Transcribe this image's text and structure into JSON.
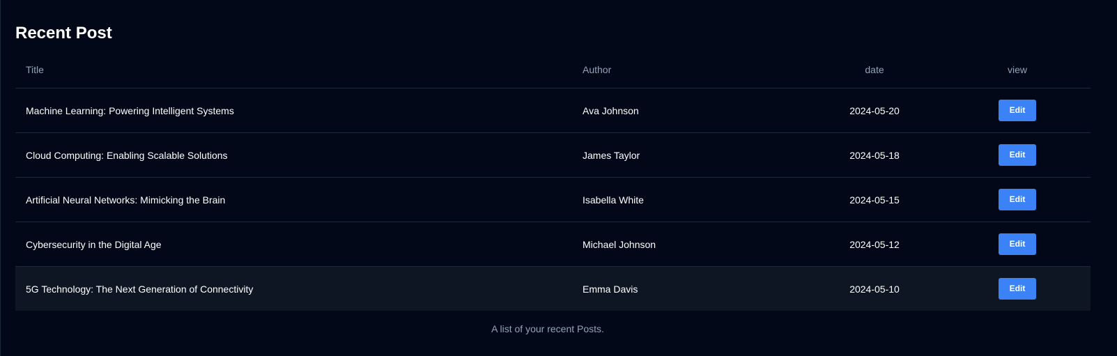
{
  "page": {
    "title": "Recent Post",
    "caption": "A list of your recent Posts."
  },
  "table": {
    "headers": {
      "title": "Title",
      "author": "Author",
      "date": "date",
      "view": "view"
    },
    "rows": [
      {
        "title": "Machine Learning: Powering Intelligent Systems",
        "author": "Ava Johnson",
        "date": "2024-05-20",
        "action": "Edit"
      },
      {
        "title": "Cloud Computing: Enabling Scalable Solutions",
        "author": "James Taylor",
        "date": "2024-05-18",
        "action": "Edit"
      },
      {
        "title": "Artificial Neural Networks: Mimicking the Brain",
        "author": "Isabella White",
        "date": "2024-05-15",
        "action": "Edit"
      },
      {
        "title": "Cybersecurity in the Digital Age",
        "author": "Michael Johnson",
        "date": "2024-05-12",
        "action": "Edit"
      },
      {
        "title": "5G Technology: The Next Generation of Connectivity",
        "author": "Emma Davis",
        "date": "2024-05-10",
        "action": "Edit"
      }
    ]
  },
  "colors": {
    "background": "#020817",
    "accent": "#3b82f6",
    "muted_text": "#94a3b8",
    "divider": "#1e293b"
  }
}
